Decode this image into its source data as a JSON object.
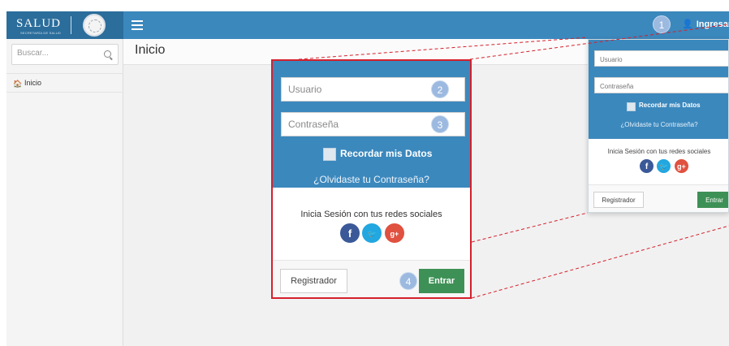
{
  "brand": {
    "name": "SALUD",
    "subtitle": "SECRETARÍA DE SALUD"
  },
  "topbar": {
    "login_label": "Ingresar",
    "step_badge": "1"
  },
  "sidebar": {
    "search_placeholder": "Buscar...",
    "items": [
      {
        "label": "Inicio",
        "icon": "home-icon"
      }
    ]
  },
  "page": {
    "title": "Inicio"
  },
  "login": {
    "username_placeholder": "Usuario",
    "password_placeholder": "Contraseña",
    "remember_label": "Recordar mis Datos",
    "forgot_link": "¿Olvidaste tu Contraseña?",
    "social_label": "Inicia Sesión con tus redes sociales",
    "social_icons": [
      {
        "name": "facebook-icon",
        "glyph": "f"
      },
      {
        "name": "twitter-icon",
        "glyph": "🐦"
      },
      {
        "name": "google-plus-icon",
        "glyph": "g+"
      }
    ],
    "register_button": "Registrador",
    "submit_button": "Entrar"
  },
  "callout_badges": {
    "username": "2",
    "password": "3",
    "submit": "4"
  },
  "colors": {
    "header_blue": "#3b88bd",
    "submit_green": "#3e9156",
    "callout_border": "#d5202c",
    "badge": "#9cb9e0"
  }
}
